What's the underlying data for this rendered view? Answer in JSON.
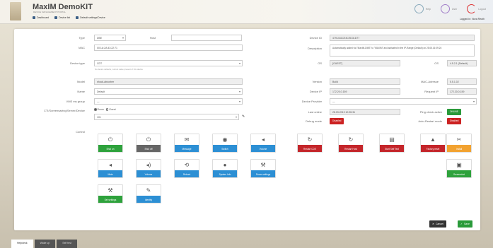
{
  "header": {
    "app_title": "MaxIM DemoKIT",
    "app_subtitle": "DEVICE MANAGEMENT PORTAL",
    "nav": [
      "Dashboard",
      "Device list",
      "Default settings/Device"
    ],
    "right_buttons": [
      "Help",
      "User",
      "Logout"
    ],
    "user_line": "Logged in: Nora Reuth"
  },
  "form": {
    "type_label": "Type",
    "type_value": "DBE",
    "host_label": "Host",
    "host_value": "",
    "mac_label": "MAC",
    "mac_value": "00:1A:2A:43:22:71",
    "device_type_label": "Device type",
    "device_type_value": "CDT",
    "device_type_hint": "No device defaults, current value present of this device",
    "model_label": "Model",
    "model_value": "shock-absorber",
    "name_label": "Name",
    "name_value": "Default",
    "msgroup_label": "VMS ms group",
    "msgroup_value": "—",
    "cti_label": "CTI/Screensaving/Server/Device",
    "cti_radio_1": "Room",
    "cti_radio_2": "Guest",
    "cti_value": "101",
    "serial_label": "Device ID",
    "serial_value": "4791441CE4CED31D77",
    "description_label": "Description",
    "description_value": "Automatically added via \"MaxIM-DMS\" to \"MAXIM\" and activated in the IP-Range (Default) on 25.05.16 09:24",
    "ip_label": "OS",
    "ip_value": "[GUEST]",
    "os_label": "OS",
    "os_value": "4.5.2.1 (Default)",
    "version_label": "Version",
    "version_value": "Build",
    "mac2_label": "MAC-Adresse",
    "mac2_value": "5.5.1.02",
    "devip_label": "Device IP",
    "devip_value": "172.20.0.159",
    "reqip_label": "Request IP",
    "reqip_value": "172.20.0.159",
    "source_label": "Device Provider",
    "source_value": "—",
    "last_online_label": "Last online",
    "last_online_value": "28.03.2019 10:35:31",
    "ping_check_label": "Ping check active",
    "online_badge": "ONLINE",
    "debug_label": "Debug mode",
    "debug_badge": "Disabled",
    "auto_restart_label": "Auto-Restart mode",
    "auto_restart_badge": "Disabled",
    "control_label": "Control"
  },
  "controls_left": [
    {
      "icon": "power-icon",
      "glyph": "⏻",
      "label": "Shut on",
      "color": "green"
    },
    {
      "icon": "power-icon",
      "glyph": "⏻",
      "label": "Shut off",
      "color": "gray"
    },
    {
      "icon": "message-icon",
      "glyph": "✉",
      "label": "Message",
      "color": "blue"
    },
    {
      "icon": "channel-icon",
      "glyph": "◉",
      "label": "Switch",
      "color": "blue"
    },
    {
      "icon": "volume-icon",
      "glyph": "◂",
      "label": "Volume",
      "color": "blue"
    },
    {
      "icon": "mute-icon",
      "glyph": "◂",
      "label": "Mute",
      "color": "blue"
    },
    {
      "icon": "volume-up-icon",
      "glyph": "◂)",
      "label": "Volume",
      "color": "blue"
    },
    {
      "icon": "reboot-icon",
      "glyph": "⟲",
      "label": "Reboot",
      "color": "blue"
    },
    {
      "icon": "info-icon",
      "glyph": "●",
      "label": "System Info",
      "color": "blue"
    },
    {
      "icon": "wrench-icon",
      "glyph": "⚒",
      "label": "Room settings",
      "color": "blue"
    },
    {
      "icon": "wrench-icon",
      "glyph": "⚒",
      "label": "Set settings",
      "color": "green"
    },
    {
      "icon": "pen-icon",
      "glyph": "✎",
      "label": "Identify",
      "color": "blue"
    }
  ],
  "controls_right": [
    {
      "icon": "refresh-icon",
      "glyph": "↻",
      "label": "Restart CDE",
      "color": "red"
    },
    {
      "icon": "refresh-icon",
      "glyph": "↻",
      "label": "Restart Host",
      "color": "red"
    },
    {
      "icon": "list-icon",
      "glyph": "▤",
      "label": "Start Self Test",
      "color": "red"
    },
    {
      "icon": "warning-icon",
      "glyph": "▲",
      "label": "Factory reset",
      "color": "red"
    },
    {
      "icon": "tools-icon",
      "glyph": "✂",
      "label": "Install",
      "color": "orange"
    },
    {
      "icon": "screenshot-icon",
      "glyph": "▣",
      "label": "Screenshot",
      "color": "green"
    }
  ],
  "footer": {
    "cancel_label": "Cancel",
    "save_label": "Save"
  },
  "bottom_tabs": [
    "Helpdesk",
    "Wake up",
    "Self test"
  ]
}
